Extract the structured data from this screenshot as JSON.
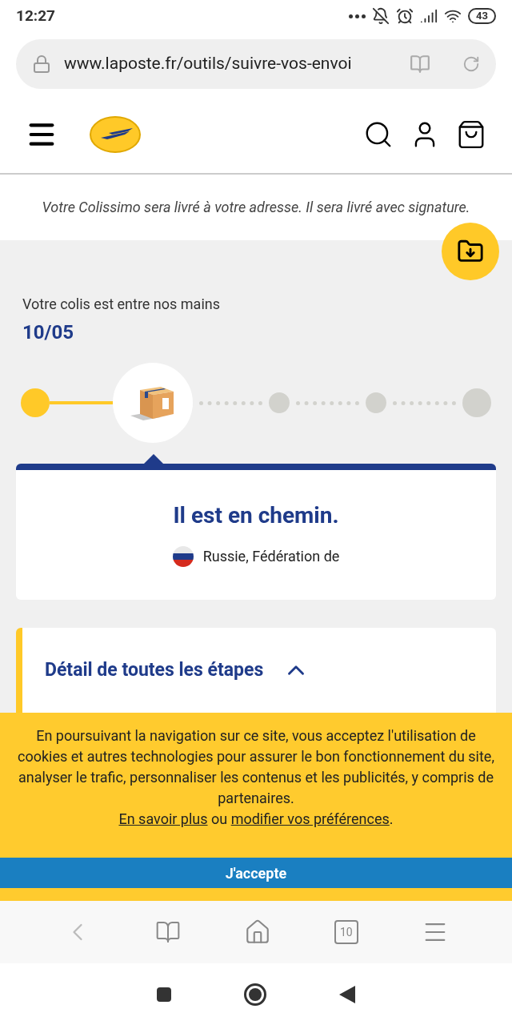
{
  "status_bar": {
    "time": "12:27",
    "battery": "43"
  },
  "browser": {
    "url": "www.laposte.fr/outils/suivre-vos-envoi",
    "tab_count": "10"
  },
  "delivery_note": "Votre Colissimo sera livré à votre adresse. Il sera livré avec signature.",
  "tracking": {
    "status_label": "Votre colis est entre nos mains",
    "date": "10/05",
    "timeline": [
      {
        "kind": "done"
      },
      {
        "kind": "current"
      },
      {
        "kind": "pending"
      },
      {
        "kind": "pending"
      },
      {
        "kind": "pending"
      }
    ],
    "headline": "Il est en chemin.",
    "country": "Russie, Fédération de"
  },
  "details": {
    "title": "Détail de toutes les étapes",
    "expanded": true
  },
  "cookie_banner": {
    "text": "En poursuivant la navigation sur ce site, vous acceptez l'utilisation de cookies et autres technologies pour assurer le bon fonctionnement du site, analyser le trafic, personnaliser les contenus et les publicités, y compris de partenaires.",
    "link_1": "En savoir plus",
    "joiner": "ou",
    "link_2": "modifier vos préférences",
    "end": ".",
    "button": "J'accepte"
  }
}
